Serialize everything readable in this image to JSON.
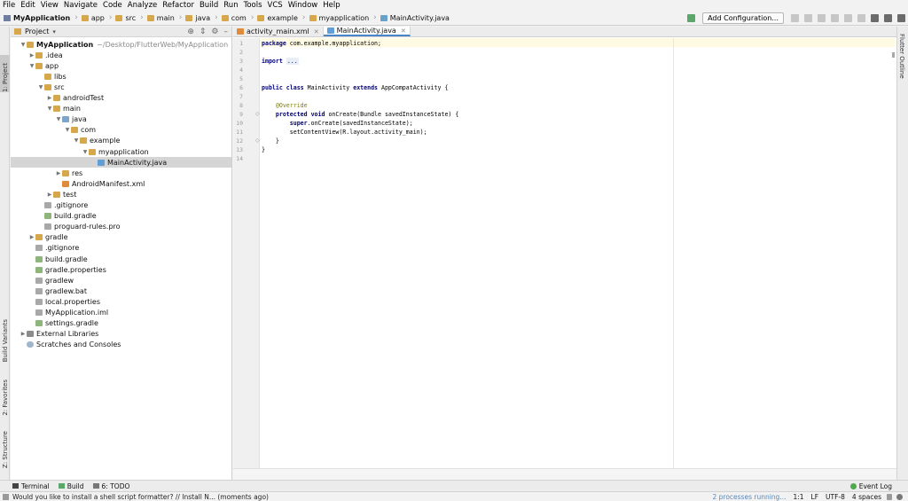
{
  "menu": [
    "File",
    "Edit",
    "View",
    "Navigate",
    "Code",
    "Analyze",
    "Refactor",
    "Build",
    "Run",
    "Tools",
    "VCS",
    "Window",
    "Help"
  ],
  "breadcrumb": [
    "MyApplication",
    "app",
    "src",
    "main",
    "java",
    "com",
    "example",
    "myapplication",
    "MainActivity.java"
  ],
  "toolbar": {
    "add_config_label": "Add Configuration..."
  },
  "left_strip": {
    "project": "1: Project",
    "build_variants": "Build Variants",
    "favorites": "2: Favorites",
    "structure": "Z: Structure"
  },
  "right_strip": {
    "flutter_outline": "Flutter Outline"
  },
  "project_panel": {
    "title": "Project",
    "tree": [
      {
        "label": "MyApplication",
        "path": "~/Desktop/FlutterWeb/MyApplication",
        "depth": 0,
        "arrow": "down",
        "icon": "folder"
      },
      {
        "label": ".idea",
        "depth": 1,
        "arrow": "right",
        "icon": "folder"
      },
      {
        "label": "app",
        "depth": 1,
        "arrow": "down",
        "icon": "folder"
      },
      {
        "label": "libs",
        "depth": 2,
        "arrow": "",
        "icon": "folder"
      },
      {
        "label": "src",
        "depth": 2,
        "arrow": "down",
        "icon": "folder"
      },
      {
        "label": "androidTest",
        "depth": 3,
        "arrow": "right",
        "icon": "folder"
      },
      {
        "label": "main",
        "depth": 3,
        "arrow": "down",
        "icon": "folder"
      },
      {
        "label": "java",
        "depth": 4,
        "arrow": "down",
        "icon": "src"
      },
      {
        "label": "com",
        "depth": 5,
        "arrow": "down",
        "icon": "folder"
      },
      {
        "label": "example",
        "depth": 6,
        "arrow": "down",
        "icon": "folder"
      },
      {
        "label": "myapplication",
        "depth": 7,
        "arrow": "down",
        "icon": "folder"
      },
      {
        "label": "MainActivity.java",
        "depth": 8,
        "arrow": "",
        "icon": "java",
        "selected": true
      },
      {
        "label": "res",
        "depth": 4,
        "arrow": "right",
        "icon": "folder"
      },
      {
        "label": "AndroidManifest.xml",
        "depth": 4,
        "arrow": "",
        "icon": "xml"
      },
      {
        "label": "test",
        "depth": 3,
        "arrow": "right",
        "icon": "folder"
      },
      {
        "label": ".gitignore",
        "depth": 2,
        "arrow": "",
        "icon": "file"
      },
      {
        "label": "build.gradle",
        "depth": 2,
        "arrow": "",
        "icon": "gradle"
      },
      {
        "label": "proguard-rules.pro",
        "depth": 2,
        "arrow": "",
        "icon": "file"
      },
      {
        "label": "gradle",
        "depth": 1,
        "arrow": "right",
        "icon": "folder"
      },
      {
        "label": ".gitignore",
        "depth": 1,
        "arrow": "",
        "icon": "file"
      },
      {
        "label": "build.gradle",
        "depth": 1,
        "arrow": "",
        "icon": "gradle"
      },
      {
        "label": "gradle.properties",
        "depth": 1,
        "arrow": "",
        "icon": "gradle"
      },
      {
        "label": "gradlew",
        "depth": 1,
        "arrow": "",
        "icon": "file"
      },
      {
        "label": "gradlew.bat",
        "depth": 1,
        "arrow": "",
        "icon": "file"
      },
      {
        "label": "local.properties",
        "depth": 1,
        "arrow": "",
        "icon": "file"
      },
      {
        "label": "MyApplication.iml",
        "depth": 1,
        "arrow": "",
        "icon": "file"
      },
      {
        "label": "settings.gradle",
        "depth": 1,
        "arrow": "",
        "icon": "gradle"
      },
      {
        "label": "External Libraries",
        "depth": 0,
        "arrow": "right",
        "icon": "lib"
      },
      {
        "label": "Scratches and Consoles",
        "depth": 0,
        "arrow": "",
        "icon": "scratch"
      }
    ]
  },
  "editor": {
    "tabs": [
      {
        "label": "activity_main.xml",
        "icon": "xml",
        "active": false
      },
      {
        "label": "MainActivity.java",
        "icon": "java",
        "active": true
      }
    ],
    "line_numbers": [
      "1",
      "2",
      "3",
      "4",
      "5",
      "6",
      "7",
      "8",
      "9",
      "10",
      "11",
      "12",
      "13",
      "14"
    ],
    "code_lines": [
      [
        {
          "t": "package",
          "c": "kw"
        },
        {
          "t": " com.example.myapplication;",
          "c": ""
        }
      ],
      [],
      [
        {
          "t": "import",
          "c": "kw"
        },
        {
          "t": " ",
          "c": ""
        },
        {
          "t": "...",
          "c": "fold-box"
        }
      ],
      [],
      [],
      [
        {
          "t": "public class",
          "c": "kw"
        },
        {
          "t": " MainActivity ",
          "c": ""
        },
        {
          "t": "extends",
          "c": "kw"
        },
        {
          "t": " AppCompatActivity {",
          "c": ""
        }
      ],
      [],
      [
        {
          "t": "    ",
          "c": ""
        },
        {
          "t": "@Override",
          "c": "ann"
        }
      ],
      [
        {
          "t": "    ",
          "c": ""
        },
        {
          "t": "protected void",
          "c": "kw"
        },
        {
          "t": " onCreate(Bundle savedInstanceState) {",
          "c": ""
        }
      ],
      [
        {
          "t": "        ",
          "c": ""
        },
        {
          "t": "super",
          "c": "kw"
        },
        {
          "t": ".onCreate(savedInstanceState);",
          "c": ""
        }
      ],
      [
        {
          "t": "        setContentView(R.layout.activity_main);",
          "c": ""
        }
      ],
      [
        {
          "t": "    }",
          "c": ""
        }
      ],
      [
        {
          "t": "}",
          "c": ""
        }
      ],
      []
    ]
  },
  "bottom_tools": [
    {
      "label": "Terminal",
      "icon": "terminal-icon"
    },
    {
      "label": "Build",
      "icon": "hammer-icon"
    },
    {
      "label": "6: TODO",
      "icon": "list-icon"
    }
  ],
  "event_log": "Event Log",
  "status": {
    "message": "Would you like to install a shell script formatter? // Install   N... (moments ago)",
    "processes": "2 processes running...",
    "position": "1:1",
    "line_sep": "LF",
    "encoding": "UTF-8",
    "indent": "4 spaces"
  }
}
